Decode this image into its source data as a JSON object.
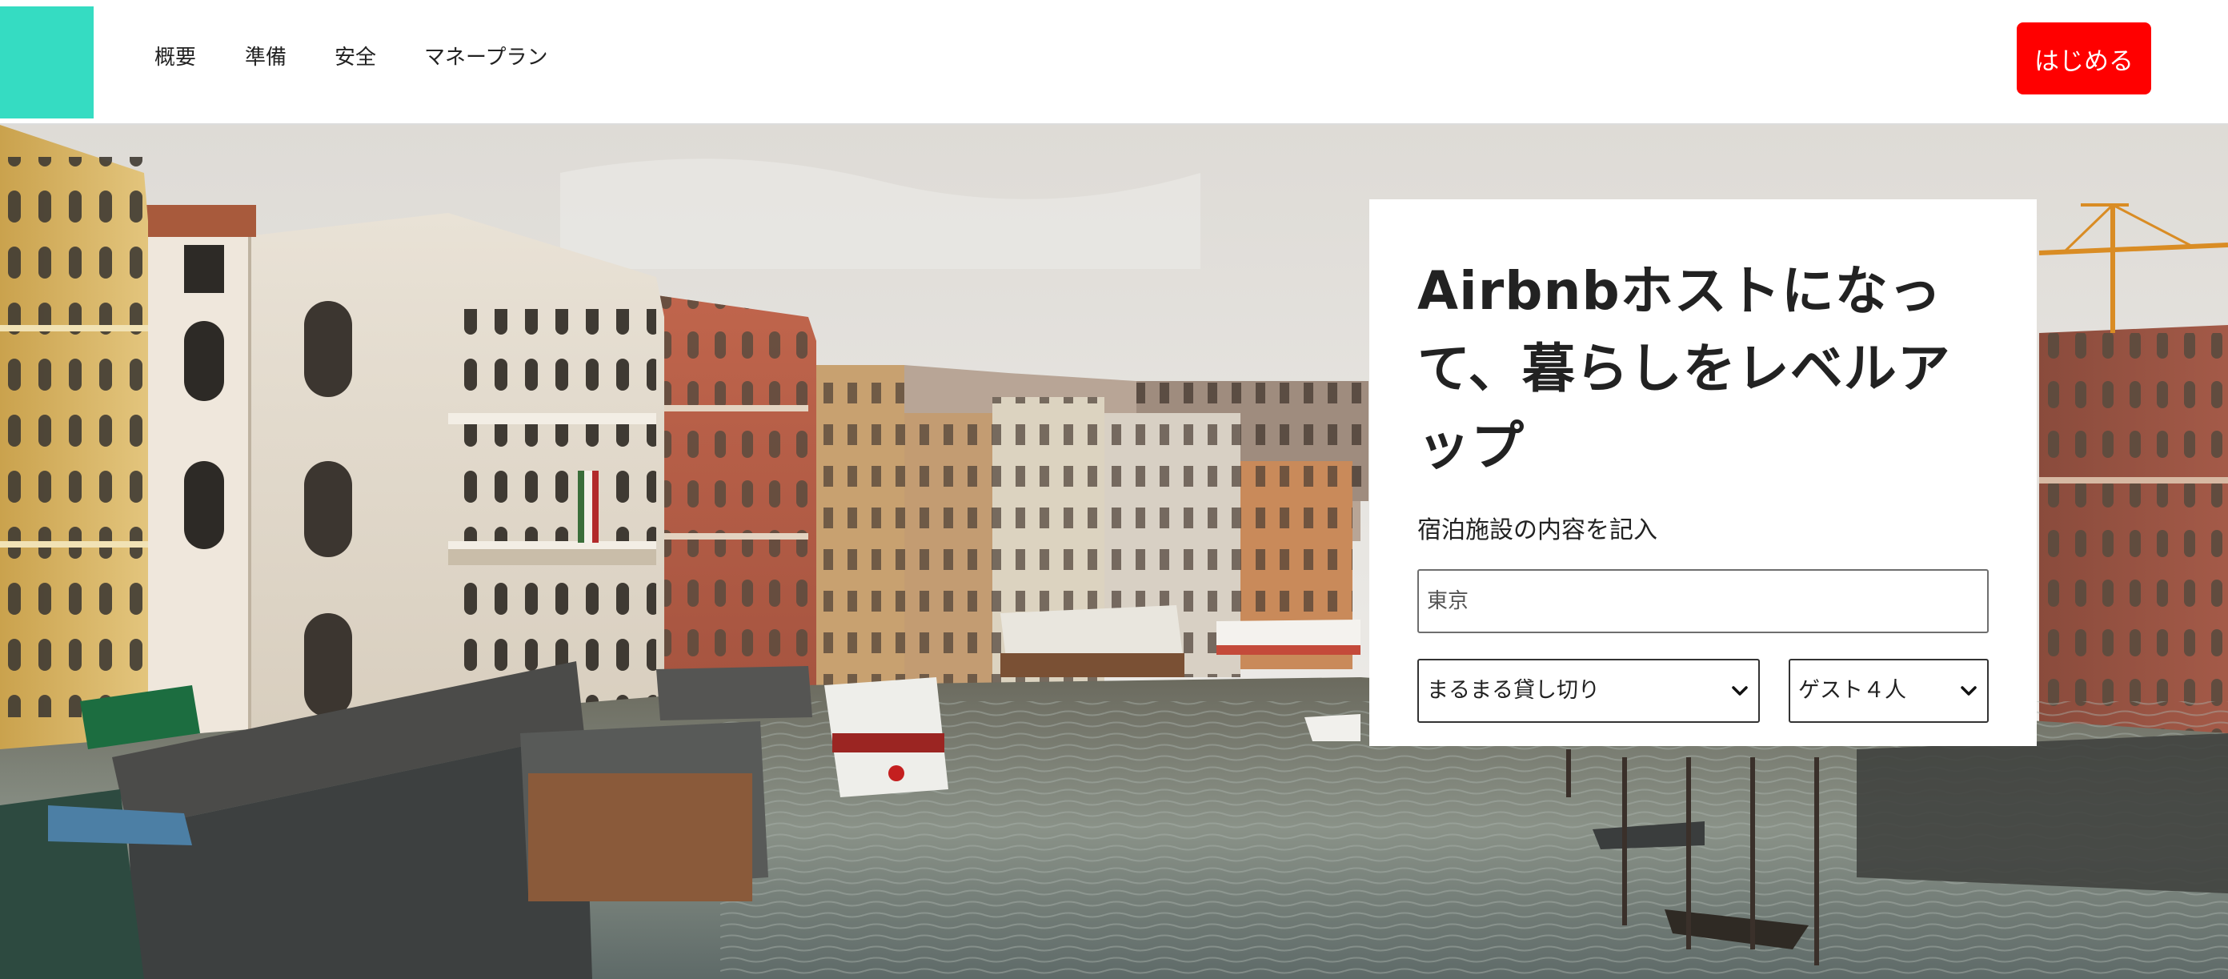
{
  "header": {
    "logo_color": "#35dcc2",
    "nav": [
      {
        "label": "概要"
      },
      {
        "label": "準備"
      },
      {
        "label": "安全"
      },
      {
        "label": "マネープラン"
      }
    ],
    "start_button": {
      "label": "はじめる",
      "color": "#ff0000"
    }
  },
  "hero": {
    "title": "Airbnbホストになって、暮らしをレベルアップ",
    "subtitle": "宿泊施設の内容を記入",
    "location_input": {
      "placeholder": "東京",
      "value": ""
    },
    "type_select": {
      "selected": "まるまる貸し切り",
      "icon": "chevron-down-icon"
    },
    "guest_select": {
      "selected": "ゲスト４人",
      "icon": "chevron-down-icon"
    }
  }
}
